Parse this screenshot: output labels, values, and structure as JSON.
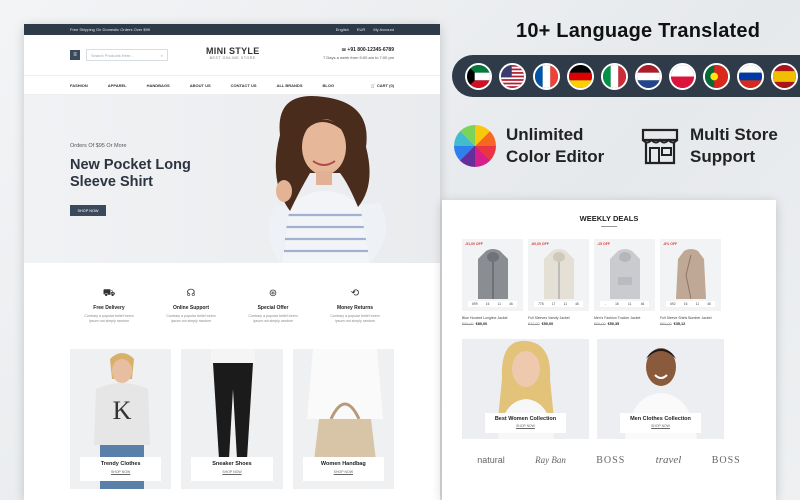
{
  "topbar": {
    "shipping": "Free Shipping On Domestic Orders Over $99",
    "language": "English",
    "currency": "EUR",
    "account": "My Account"
  },
  "header": {
    "search_placeholder": "Search Products Here...",
    "logo_title": "MINI STYLE",
    "logo_subtitle": "BEST ONLINE STORE",
    "phone": "+91 800-12345-6789",
    "hours": "7 Days a week from 9:00 am to 7:00 pm"
  },
  "nav": {
    "items": [
      "FASHION",
      "APPAREL",
      "HANDBAGS",
      "ABOUT US",
      "CONTACT US",
      "ALL BRANDS",
      "BLOG"
    ],
    "cart": "CART (0)"
  },
  "hero": {
    "kicker": "Orders Of $95 Or More",
    "title_line1": "New Pocket Long",
    "title_line2": "Sleeve Shirt",
    "button": "SHOP NOW"
  },
  "features": [
    {
      "icon": "truck-icon",
      "title": "Free Delivery",
      "desc1": "Contrary a popular belief lorem",
      "desc2": "ipsum not simply random"
    },
    {
      "icon": "headset-icon",
      "title": "Online Support",
      "desc1": "Contrary a popular belief lorem",
      "desc2": "ipsum not simply random"
    },
    {
      "icon": "discount-icon",
      "title": "Special Offer",
      "desc1": "Contrary a popular belief lorem",
      "desc2": "ipsum not simply random"
    },
    {
      "icon": "money-return-icon",
      "title": "Money Returns",
      "desc1": "Contrary a popular belief lorem",
      "desc2": "ipsum not simply random"
    }
  ],
  "categories": [
    {
      "name": "Trendy Clothes",
      "link": "SHOP NOW"
    },
    {
      "name": "Sneaker Shoes",
      "link": "SHOP NOW"
    },
    {
      "name": "Women Handbag",
      "link": "SHOP NOW"
    }
  ],
  "promo": {
    "headline": "10+ Language Translated",
    "flags": [
      "kuwait-flag-icon",
      "usa-flag-icon",
      "france-flag-icon",
      "germany-flag-icon",
      "italy-flag-icon",
      "netherlands-flag-icon",
      "poland-flag-icon",
      "portugal-flag-icon",
      "russia-flag-icon",
      "spain-flag-icon"
    ],
    "color_line1": "Unlimited",
    "color_line2": "Color Editor",
    "store_line1": "Multi Store",
    "store_line2": "Support"
  },
  "deals": {
    "title": "WEEKLY DEALS",
    "products": [
      {
        "off": "-51,00 OFF",
        "timer": [
          "699",
          "16",
          "11",
          "46"
        ],
        "name": "Blue Hooded Longline Jacket",
        "old": "€99,00",
        "price": "€80,00"
      },
      {
        "off": "-60,00 OFF",
        "timer": [
          "778",
          "17",
          "11",
          "46"
        ],
        "name": "Full Sleeves Varsity Jacket",
        "old": "€37,00",
        "price": "€50,00"
      },
      {
        "off": "-15 OFF",
        "timer": [
          "-",
          "16",
          "11",
          "46"
        ],
        "name": "Men's Fashion Trucker Jacket",
        "old": "€66,00",
        "price": "€50,35"
      },
      {
        "off": "-8% OFF",
        "timer": [
          "692",
          "16",
          "11",
          "46"
        ],
        "name": "Full Sleeve Shirts Bomber Jacket",
        "old": "€60,00",
        "price": "€35,12"
      }
    ]
  },
  "collections": [
    {
      "name": "Best Women Collection",
      "link": "SHOP NOW"
    },
    {
      "name": "Men Clothes Collection",
      "link": "SHOP NOW"
    }
  ],
  "brands": [
    "natural",
    "Ray Ban",
    "BOSS",
    "travel",
    "BOSS"
  ],
  "colors": {
    "dark": "#2f3b49",
    "button": "#3b4a5a",
    "sale": "#e53935"
  }
}
